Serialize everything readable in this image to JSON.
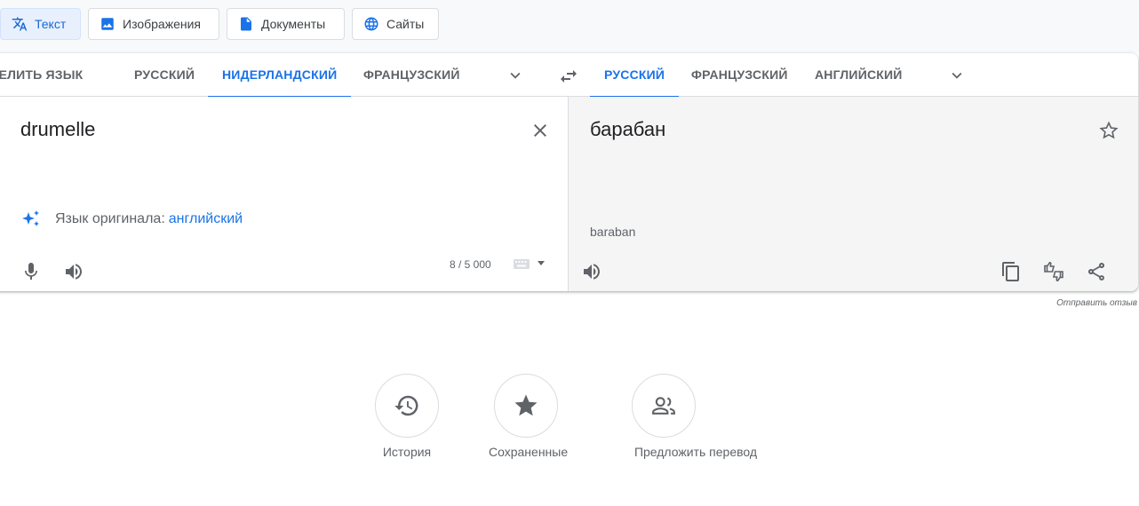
{
  "modes": {
    "text": "Текст",
    "images": "Изображения",
    "documents": "Документы",
    "sites": "Сайты"
  },
  "source_langs": {
    "detect": "ОПРЕДЕЛИТЬ ЯЗЫК",
    "tab1": "РУССКИЙ",
    "tab2": "НИДЕРЛАНДСКИЙ",
    "tab3": "ФРАНЦУЗСКИЙ",
    "active": "НИДЕРЛАНДСКИЙ"
  },
  "target_langs": {
    "tab1": "РУССКИЙ",
    "tab2": "ФРАНЦУЗСКИЙ",
    "tab3": "АНГЛИЙСКИЙ",
    "active": "РУССКИЙ"
  },
  "source": {
    "text": "drumelle",
    "detected_prefix": "Язык оригинала:",
    "detected_lang": "английский",
    "char_count": "8 / 5 000"
  },
  "target": {
    "text": "барабан",
    "transliteration": "baraban"
  },
  "feedback": "Отправить отзыв",
  "actions": {
    "history": "История",
    "saved": "Сохраненные",
    "suggest": "Предложить перевод"
  },
  "colors": {
    "accent": "#1a73e8",
    "icon": "#5f6368",
    "target_bg": "#f5f5f5"
  }
}
